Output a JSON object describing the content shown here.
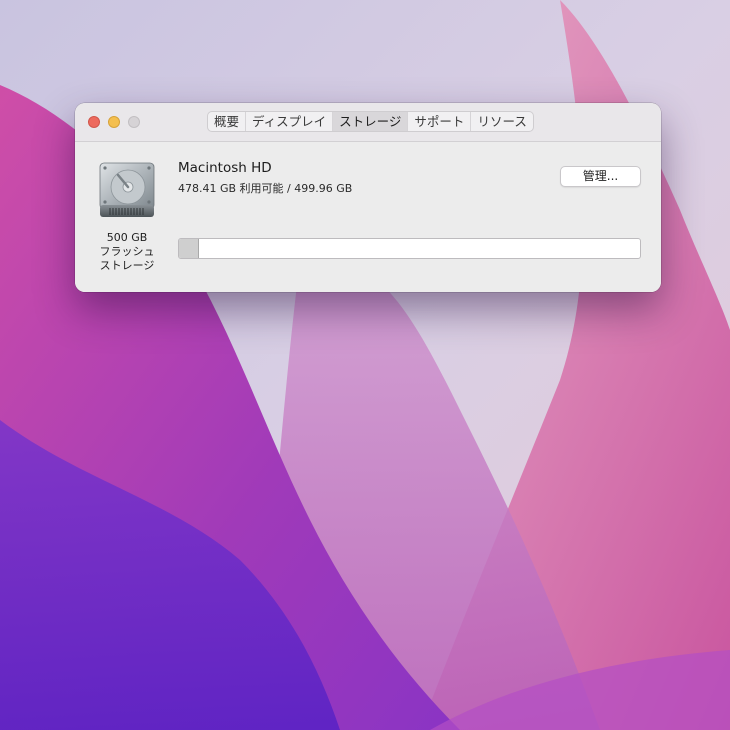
{
  "tabs": [
    {
      "label": "概要",
      "active": false
    },
    {
      "label": "ディスプレイ",
      "active": false
    },
    {
      "label": "ストレージ",
      "active": true
    },
    {
      "label": "サポート",
      "active": false
    },
    {
      "label": "リソース",
      "active": false
    }
  ],
  "storage": {
    "drive_caption_line1": "500 GB",
    "drive_caption_line2": "フラッシュ",
    "drive_caption_line3": "ストレージ",
    "volume_name": "Macintosh HD",
    "availability": "478.41 GB 利用可能 / 499.96 GB",
    "manage_label": "管理...",
    "used_fraction": 0.043
  },
  "colors": {
    "close": "#ed6a5e",
    "minimize": "#f4bf4f",
    "zoom_disabled": "#d6d3d6"
  }
}
